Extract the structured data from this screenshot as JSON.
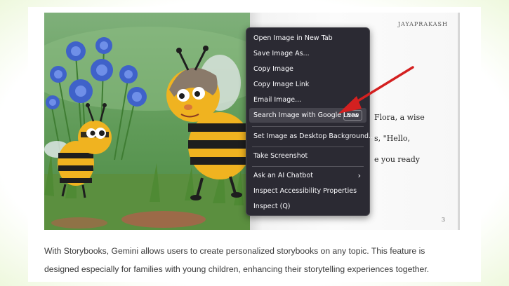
{
  "book": {
    "author": "JAYAPRAKASH",
    "text_lines": [
      "Flora, a wise",
      "s, \"Hello,",
      "e you ready"
    ],
    "page_number": "3"
  },
  "context_menu": {
    "items": [
      "Open Image in New Tab",
      "Save Image As...",
      "Copy Image",
      "Copy Image Link",
      "Email Image...",
      "Search Image with Google Lens",
      "Set Image as Desktop Background...",
      "Take Screenshot",
      "Ask an AI Chatbot",
      "Inspect Accessibility Properties",
      "Inspect (Q)"
    ],
    "new_badge": "New",
    "submenu_chevron": "›"
  },
  "caption": {
    "line1": "With Storybooks, Gemini allows users to create personalized storybooks on any topic. This feature is",
    "line2": "designed especially for families with young children, enhancing their storytelling experiences together."
  },
  "colors": {
    "menu_bg": "#2b2a33",
    "menu_hover": "#45444d",
    "arrow": "#d42020"
  },
  "icons": {
    "arrow": "red-arrow-annotation",
    "chevron": "chevron-right-icon"
  }
}
